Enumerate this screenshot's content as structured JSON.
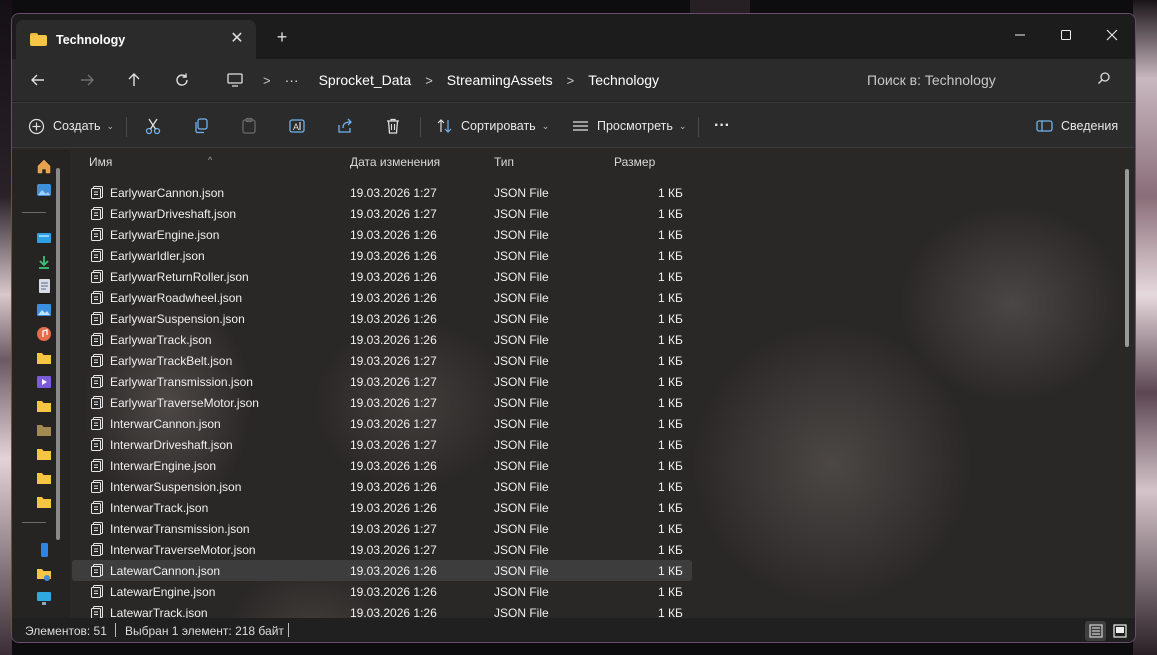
{
  "window": {
    "tab_title": "Technology",
    "tab_close_glyph": "✕",
    "new_tab_glyph": "+"
  },
  "breadcrumb": {
    "more": "···",
    "items": [
      "Sprocket_Data",
      "StreamingAssets",
      "Technology"
    ],
    "separator": ">"
  },
  "search": {
    "placeholder": "Поиск в: Technology"
  },
  "toolbar": {
    "create_label": "Создать",
    "sort_label": "Сортировать",
    "view_label": "Просмотреть",
    "more_glyph": "···",
    "details_label": "Сведения",
    "chevron": "⌄"
  },
  "columns": {
    "name": "Имя",
    "date": "Дата изменения",
    "type": "Тип",
    "size": "Размер",
    "sort_glyph": "^"
  },
  "files": [
    {
      "name": "EarlywarCannon.json",
      "date": "19.03.2026 1:27",
      "type": "JSON File",
      "size": "1 КБ"
    },
    {
      "name": "EarlywarDriveshaft.json",
      "date": "19.03.2026 1:27",
      "type": "JSON File",
      "size": "1 КБ"
    },
    {
      "name": "EarlywarEngine.json",
      "date": "19.03.2026 1:26",
      "type": "JSON File",
      "size": "1 КБ"
    },
    {
      "name": "EarlywarIdler.json",
      "date": "19.03.2026 1:26",
      "type": "JSON File",
      "size": "1 КБ"
    },
    {
      "name": "EarlywarReturnRoller.json",
      "date": "19.03.2026 1:26",
      "type": "JSON File",
      "size": "1 КБ"
    },
    {
      "name": "EarlywarRoadwheel.json",
      "date": "19.03.2026 1:26",
      "type": "JSON File",
      "size": "1 КБ"
    },
    {
      "name": "EarlywarSuspension.json",
      "date": "19.03.2026 1:26",
      "type": "JSON File",
      "size": "1 КБ"
    },
    {
      "name": "EarlywarTrack.json",
      "date": "19.03.2026 1:26",
      "type": "JSON File",
      "size": "1 КБ"
    },
    {
      "name": "EarlywarTrackBelt.json",
      "date": "19.03.2026 1:27",
      "type": "JSON File",
      "size": "1 КБ"
    },
    {
      "name": "EarlywarTransmission.json",
      "date": "19.03.2026 1:27",
      "type": "JSON File",
      "size": "1 КБ"
    },
    {
      "name": "EarlywarTraverseMotor.json",
      "date": "19.03.2026 1:27",
      "type": "JSON File",
      "size": "1 КБ"
    },
    {
      "name": "InterwarCannon.json",
      "date": "19.03.2026 1:27",
      "type": "JSON File",
      "size": "1 КБ"
    },
    {
      "name": "InterwarDriveshaft.json",
      "date": "19.03.2026 1:27",
      "type": "JSON File",
      "size": "1 КБ"
    },
    {
      "name": "InterwarEngine.json",
      "date": "19.03.2026 1:26",
      "type": "JSON File",
      "size": "1 КБ"
    },
    {
      "name": "InterwarSuspension.json",
      "date": "19.03.2026 1:26",
      "type": "JSON File",
      "size": "1 КБ"
    },
    {
      "name": "InterwarTrack.json",
      "date": "19.03.2026 1:26",
      "type": "JSON File",
      "size": "1 КБ"
    },
    {
      "name": "InterwarTransmission.json",
      "date": "19.03.2026 1:27",
      "type": "JSON File",
      "size": "1 КБ"
    },
    {
      "name": "InterwarTraverseMotor.json",
      "date": "19.03.2026 1:27",
      "type": "JSON File",
      "size": "1 КБ"
    },
    {
      "name": "LatewarCannon.json",
      "date": "19.03.2026 1:26",
      "type": "JSON File",
      "size": "1 КБ",
      "selected": true
    },
    {
      "name": "LatewarEngine.json",
      "date": "19.03.2026 1:26",
      "type": "JSON File",
      "size": "1 КБ"
    },
    {
      "name": "LatewarTrack.json",
      "date": "19.03.2026 1:26",
      "type": "JSON File",
      "size": "1 КБ"
    }
  ],
  "status": {
    "count": "Элементов: 51",
    "selection": "Выбран 1 элемент: 218 байт"
  },
  "colors": {
    "window_bg": "#202020",
    "folder": "#f5c543",
    "accent_border": "#6a4a6e"
  }
}
